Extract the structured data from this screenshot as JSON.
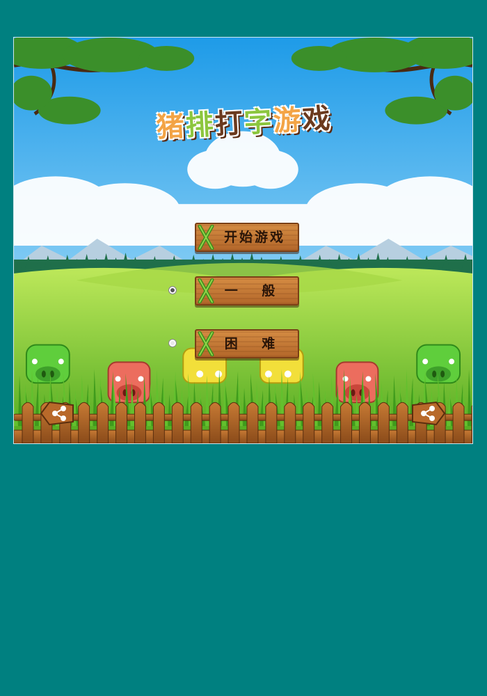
{
  "game": {
    "title": "猪排打字游戏",
    "title_chars": [
      "猪",
      "排",
      "打",
      "字",
      "游",
      "戏"
    ],
    "start_label": "开始游戏",
    "difficulty": {
      "normal_label": "一 般",
      "hard_label": "困 难",
      "selected": "normal"
    }
  },
  "colors": {
    "page_background": "#008080",
    "sky": "#49b3f1",
    "grass": "#6fc22a",
    "wood": "#c77a34",
    "pig_green": "#5fce3c",
    "pig_red": "#ec6d5e",
    "pig_yellow": "#f2df3a"
  },
  "icons": [
    "tree-branch",
    "cloud",
    "mountain",
    "pine-tree",
    "pig",
    "fence",
    "share-icon",
    "x-mark-icon"
  ]
}
